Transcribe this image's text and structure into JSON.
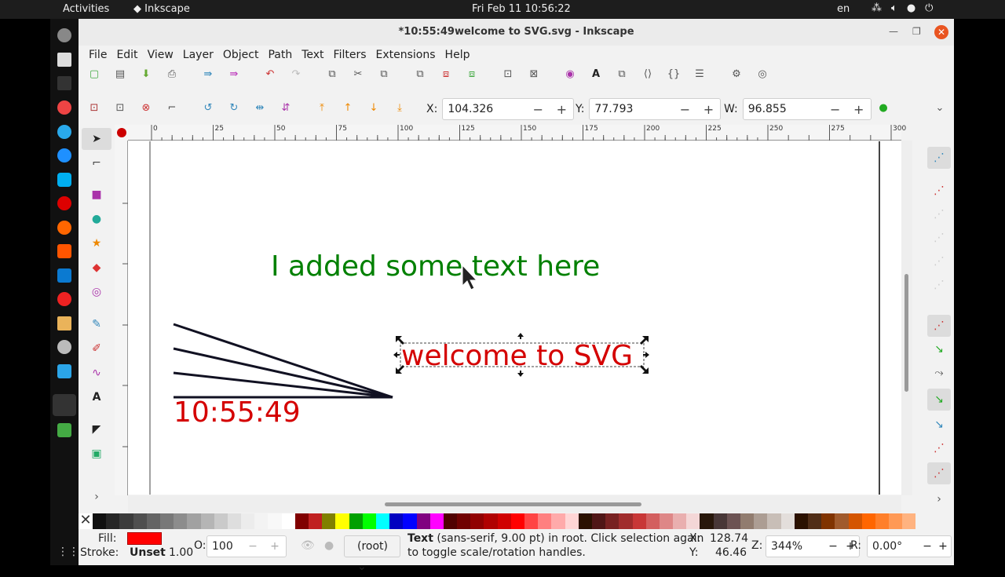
{
  "topbar": {
    "activities": "Activities",
    "app": "Inkscape",
    "clock": "Fri Feb 11  10:56:22",
    "lang": "en"
  },
  "window": {
    "title": "*10:55:49welcome to SVG.svg - Inkscape"
  },
  "menu": [
    "File",
    "Edit",
    "View",
    "Layer",
    "Object",
    "Path",
    "Text",
    "Filters",
    "Extensions",
    "Help"
  ],
  "controls": {
    "x_label": "X:",
    "x_value": "104.326",
    "y_label": "Y:",
    "y_value": "77.793",
    "w_label": "W:",
    "w_value": "96.855"
  },
  "ruler": {
    "h_ticks": [
      "0",
      "25",
      "50",
      "75",
      "100",
      "125",
      "150",
      "175",
      "200",
      "225",
      "250",
      "275",
      "300"
    ]
  },
  "canvas": {
    "text_green": "I added some text here",
    "text_red_selected": "welcome to SVG",
    "text_time": "10:55:49",
    "green_color": "#008000",
    "red_color": "#d40000"
  },
  "palette": [
    "#111111",
    "#262626",
    "#3b3b3b",
    "#4f4f4f",
    "#646464",
    "#787878",
    "#8c8c8c",
    "#a1a1a1",
    "#b5b5b5",
    "#cacaca",
    "#dedede",
    "#ececec",
    "#f3f3f3",
    "#f8f8f8",
    "#ffffff",
    "#800000",
    "#c02020",
    "#808000",
    "#ffff00",
    "#00a000",
    "#00ff00",
    "#00ffff",
    "#0000c0",
    "#0000ff",
    "#800080",
    "#ff00ff",
    "#500000",
    "#700000",
    "#900000",
    "#b00000",
    "#d00000",
    "#ff0000",
    "#ff4444",
    "#ff8080",
    "#ffaaaa",
    "#ffd5d5",
    "#2b1100",
    "#501616",
    "#782121",
    "#a02c2c",
    "#c83737",
    "#d35f5f",
    "#de8787",
    "#e9afaf",
    "#f4d7d7",
    "#28170b",
    "#483737",
    "#6c5353",
    "#917c6f",
    "#ac9d93",
    "#c8beb7",
    "#e3dedb",
    "#2b1100",
    "#502d16",
    "#803300",
    "#a05a2c",
    "#d45500",
    "#ff6600",
    "#ff7f2a",
    "#ff9955",
    "#ffb380"
  ],
  "status": {
    "fill_label": "Fill:",
    "stroke_label": "Stroke:",
    "stroke_value": "Unset",
    "stroke_width": "1.00",
    "opacity_label": "O:",
    "opacity_value": "100",
    "layer": "(root)",
    "message_bold": "Text",
    "message_line1": " (sans-serif, 9.00 pt) in root. Click selection again",
    "message_line2": "to toggle scale/rotation handles.",
    "cx_label": "X:",
    "cx_value": "128.74",
    "cy_label": "Y:",
    "cy_value": "46.46",
    "zoom_label": "Z:",
    "zoom_value": "344%",
    "rot_label": "R:",
    "rot_value": "0.00°"
  }
}
